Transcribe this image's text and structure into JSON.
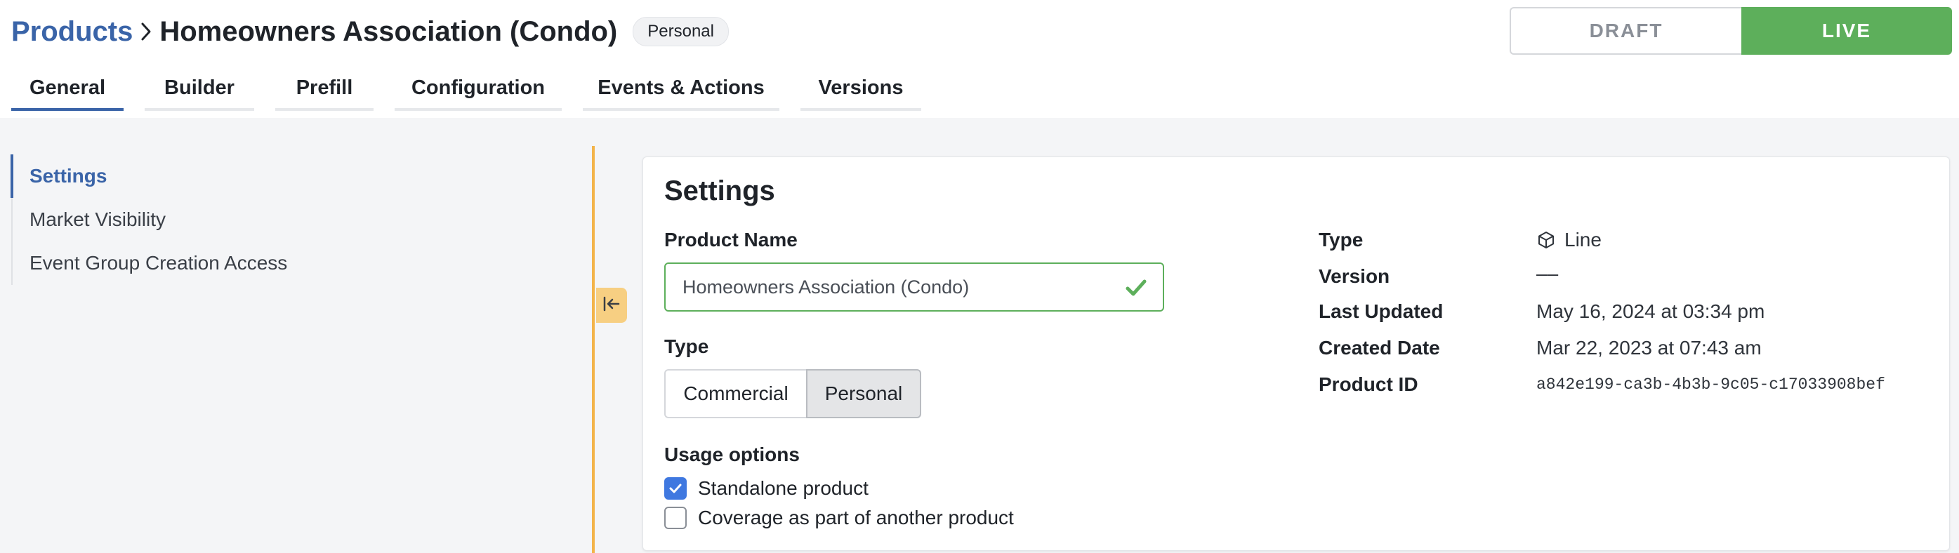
{
  "breadcrumb": {
    "root": "Products",
    "current": "Homeowners Association (Condo)",
    "badge": "Personal"
  },
  "status_toggle": {
    "draft": "DRAFT",
    "live": "LIVE",
    "active": "LIVE",
    "live_color": "#5daf5b"
  },
  "tabs": [
    {
      "label": "General",
      "active": true
    },
    {
      "label": "Builder"
    },
    {
      "label": "Prefill"
    },
    {
      "label": "Configuration"
    },
    {
      "label": "Events & Actions"
    },
    {
      "label": "Versions"
    }
  ],
  "side_nav": {
    "items": [
      {
        "label": "Settings",
        "active": true
      },
      {
        "label": "Market Visibility"
      },
      {
        "label": "Event Group Creation Access"
      }
    ]
  },
  "settings": {
    "title": "Settings",
    "product_name_label": "Product Name",
    "product_name_value": "Homeowners Association (Condo)",
    "type_label": "Type",
    "type_options": [
      "Commercial",
      "Personal"
    ],
    "type_selected": "Personal",
    "usage_label": "Usage options",
    "usage_options": [
      {
        "label": "Standalone product",
        "checked": true
      },
      {
        "label": "Coverage as part of another product",
        "checked": false
      }
    ],
    "meta": {
      "type_label": "Type",
      "type_value": "Line",
      "type_icon": "cube-icon",
      "version_label": "Version",
      "version_value": "––",
      "last_updated_label": "Last Updated",
      "last_updated_value": "May 16, 2024 at 03:34 pm",
      "created_label": "Created Date",
      "created_value": "Mar 22, 2023 at 07:43 am",
      "product_id_label": "Product ID",
      "product_id_value": "a842e199-ca3b-4b3b-9c05-c17033908bef"
    }
  },
  "colors": {
    "accent": "#3a64a8",
    "success": "#5daf5b",
    "splitter": "#f3b44a",
    "checkbox": "#3f78e0"
  }
}
